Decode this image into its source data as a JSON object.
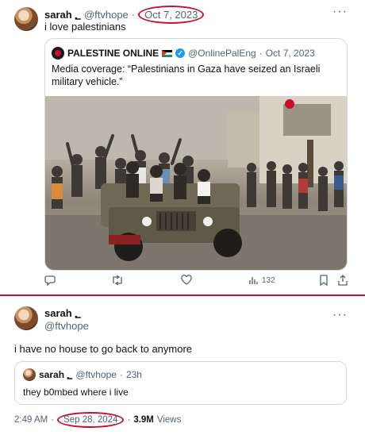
{
  "tweet1": {
    "name": "sarah ؂",
    "handle": "@ftvhope",
    "separator": "·",
    "date": "Oct 7, 2023",
    "text": "i love palestinians",
    "more": "···"
  },
  "quote1": {
    "name": "PALESTINE ONLINE",
    "handle": "@OnlinePalEng",
    "separator": "·",
    "date": "Oct 7, 2023",
    "text": "Media coverage: “Palestinians in Gaza have seized an Israeli military vehicle.”"
  },
  "actions": {
    "views": "132",
    "icons": [
      "reply-icon",
      "retweet-icon",
      "like-icon",
      "views-icon",
      "bookmark-icon",
      "share-icon"
    ]
  },
  "tweet2": {
    "name": "sarah ؂",
    "handle": "@ftvhope",
    "more": "···",
    "text": "i have no house to go back to anymore",
    "time": "2:49 AM",
    "separator": "·",
    "date": "Sep 28, 2024",
    "views_count": "3.9M",
    "views_label": "Views"
  },
  "quote2": {
    "name": "sarah ؂",
    "handle": "@ftvhope",
    "separator": "·",
    "age": "23h",
    "text": "they b0mbed where i live"
  },
  "colors": {
    "annotation_red": "#c8102e",
    "secondary_text": "#536471",
    "border": "#cfd9de",
    "verified_blue": "#1d9bf0"
  }
}
